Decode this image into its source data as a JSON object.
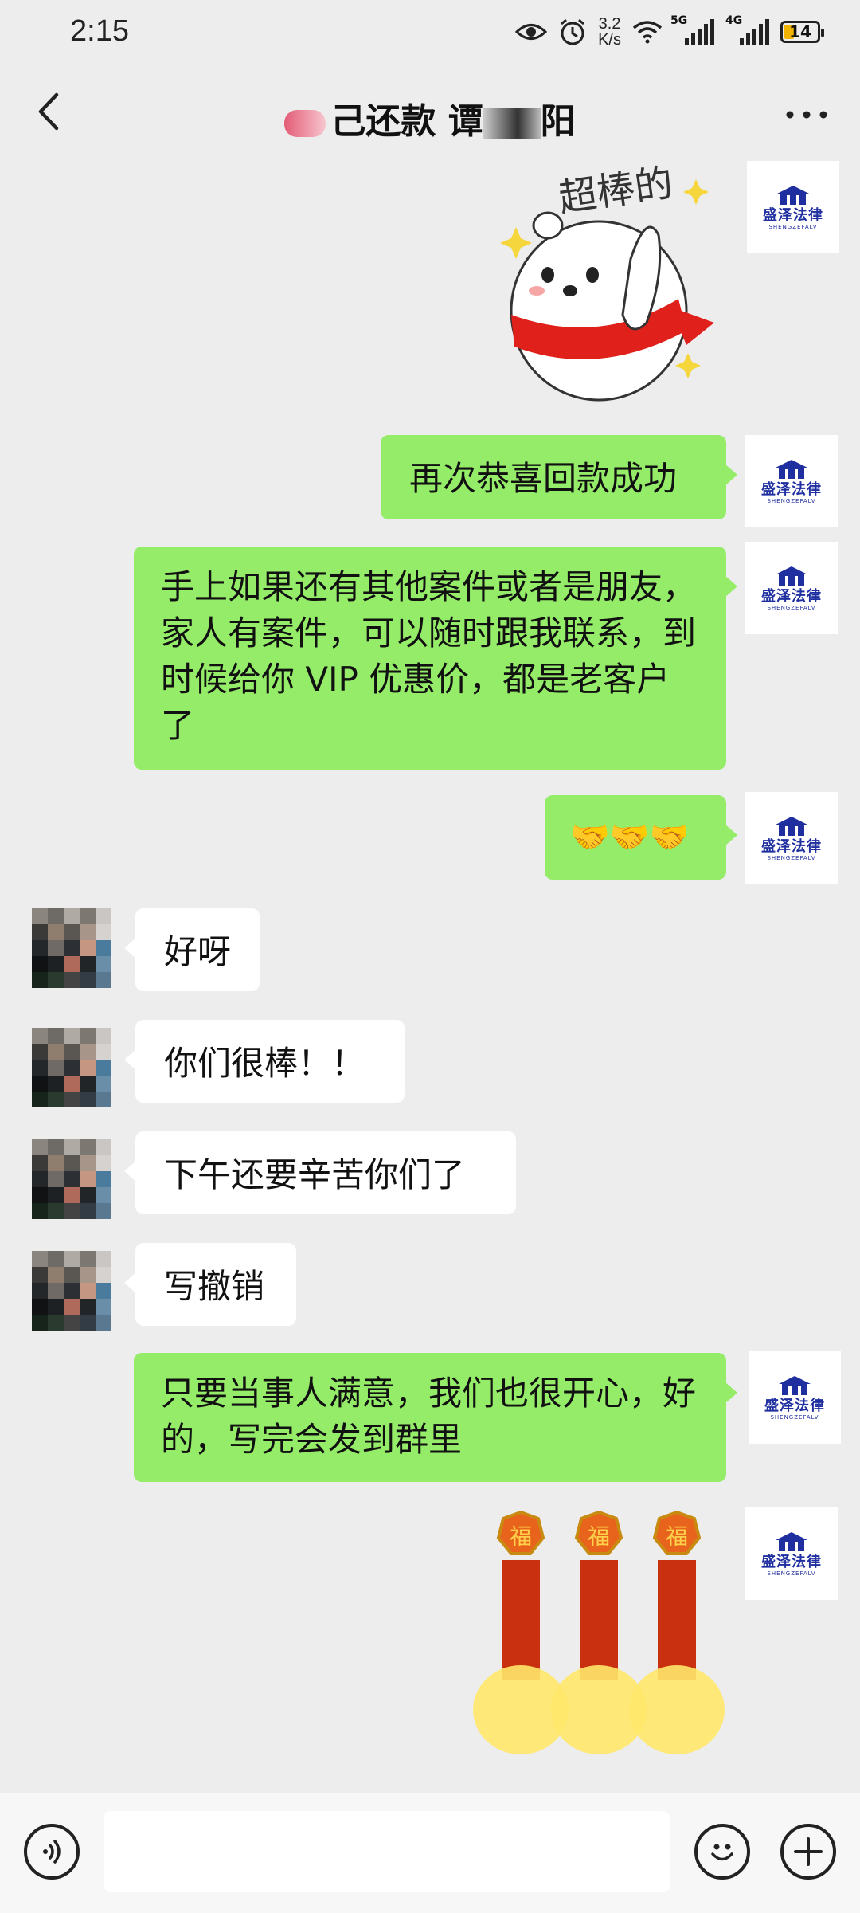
{
  "status_bar": {
    "time": "2:15",
    "net_speed_value": "3.2",
    "net_speed_unit": "K/s",
    "sig1_tag": "5G",
    "sig2_tag": "4G",
    "battery": "14"
  },
  "header": {
    "title_visible": "己还款 谭",
    "title_end": "阳",
    "more_label": "···"
  },
  "logo": {
    "cn": "盛泽法律",
    "en": "SHENGZEFALV"
  },
  "messages": [
    {
      "side": "me",
      "type": "sticker",
      "sticker": "bear-thumbs-up",
      "caption": "超棒的"
    },
    {
      "side": "me",
      "type": "text",
      "text": "再次恭喜回款成功"
    },
    {
      "side": "me",
      "type": "text",
      "text": "手上如果还有其他案件或者是朋友，家人有案件，可以随时跟我联系，到时候给你 VIP 优惠价，都是老客户了"
    },
    {
      "side": "me",
      "type": "text",
      "text": "🤝🤝🤝"
    },
    {
      "side": "them",
      "type": "text",
      "text": "好呀"
    },
    {
      "side": "them",
      "type": "text",
      "text": "你们很棒！！"
    },
    {
      "side": "them",
      "type": "text",
      "text": "下午还要辛苦你们了"
    },
    {
      "side": "them",
      "type": "text",
      "text": "写撤销"
    },
    {
      "side": "me",
      "type": "text",
      "text": "只要当事人满意，我们也很开心，好的，写完会发到群里"
    },
    {
      "side": "me",
      "type": "sticker",
      "sticker": "firecrackers",
      "caption": "福"
    }
  ],
  "colors": {
    "me_bubble": "#95ec69",
    "them_bubble": "#ffffff",
    "background": "#ededed",
    "logo_blue": "#1f2fa0"
  }
}
